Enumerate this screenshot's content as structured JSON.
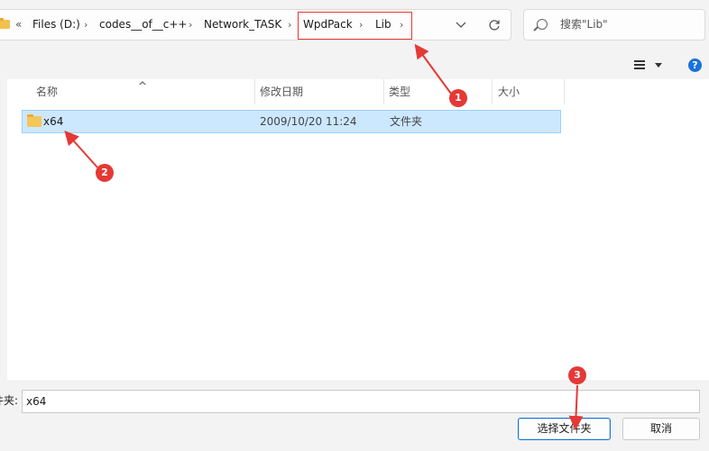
{
  "address_bar": {
    "overflow": "«",
    "crumbs": [
      "Files (D:)",
      "codes__of__c++",
      "Network_TASK",
      "WpdPack",
      "Lib"
    ],
    "separator": "›"
  },
  "search": {
    "placeholder": "搜索\"Lib\""
  },
  "columns": {
    "name": "名称",
    "date": "修改日期",
    "type": "类型",
    "size": "大小"
  },
  "files": [
    {
      "name": "x64",
      "date": "2009/10/20 11:24",
      "type": "文件夹",
      "size": ""
    }
  ],
  "filename": {
    "label": "件夹:",
    "value": "x64"
  },
  "buttons": {
    "select": "选择文件夹",
    "cancel": "取消"
  },
  "help": "?",
  "annotations": [
    "1",
    "2",
    "3"
  ],
  "colors": {
    "annotation": "#e53935",
    "selection": "#cce8ff",
    "accent": "#1a73d9"
  }
}
